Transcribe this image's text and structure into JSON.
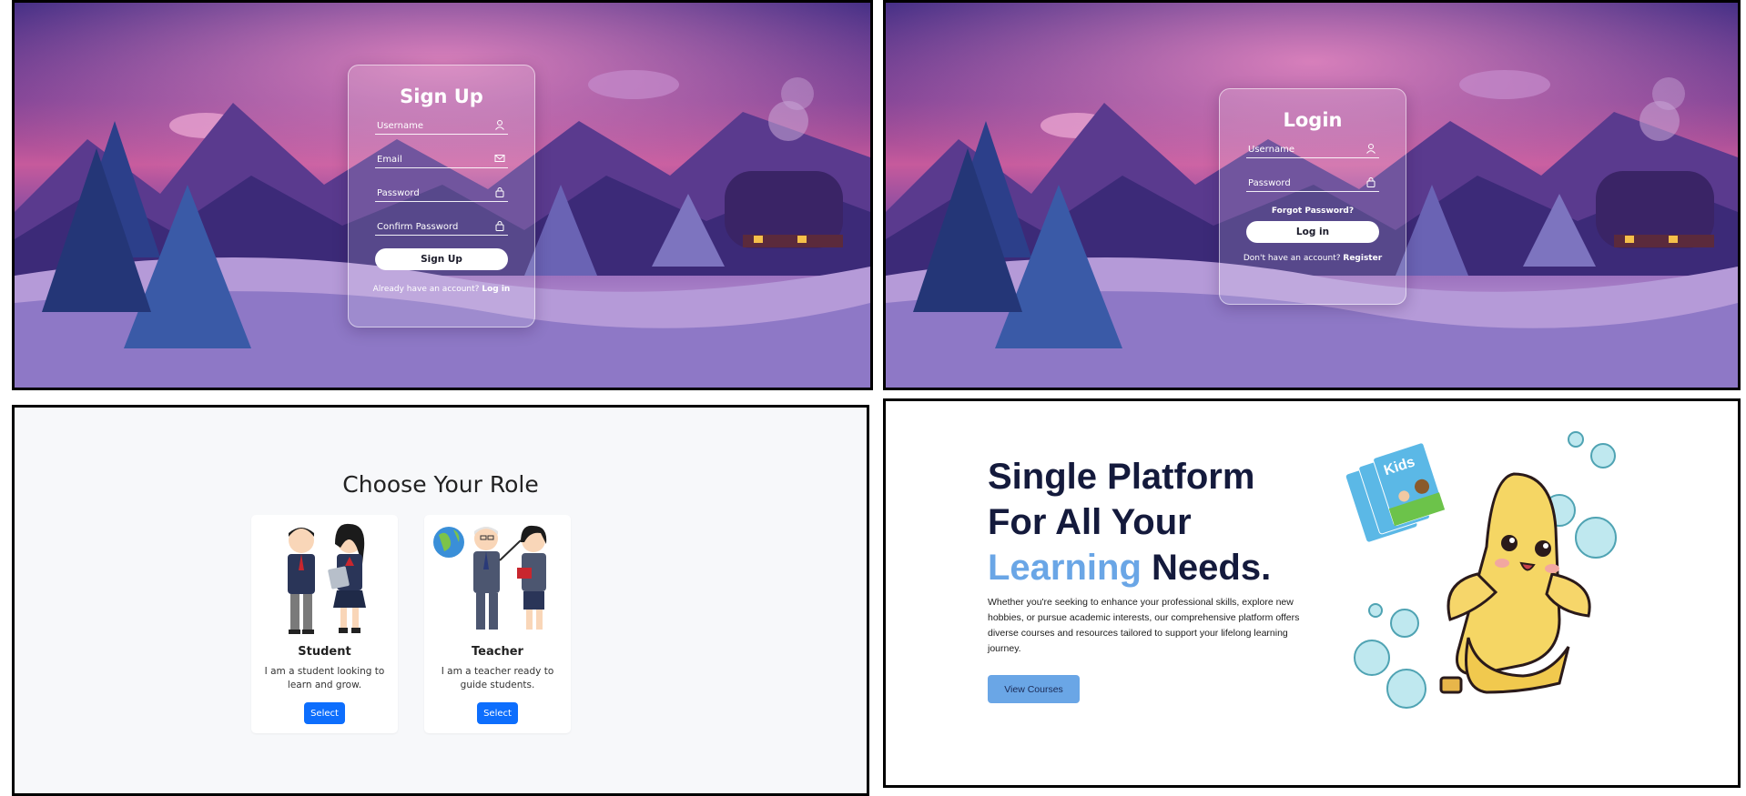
{
  "signup": {
    "title": "Sign Up",
    "username_placeholder": "Username",
    "email_placeholder": "Email",
    "password_placeholder": "Password",
    "confirm_placeholder": "Confirm Password",
    "button_label": "Sign Up",
    "footer_text": "Already have an account?",
    "footer_link": "Log in"
  },
  "login": {
    "title": "Login",
    "username_placeholder": "Username",
    "password_placeholder": "Password",
    "forgot_link": "Forgot Password?",
    "button_label": "Log in",
    "footer_text": "Don't have an account?",
    "footer_link": "Register"
  },
  "roles": {
    "title": "Choose Your Role",
    "cards": [
      {
        "name": "Student",
        "description": "I am a student looking to learn and grow.",
        "button_label": "Select"
      },
      {
        "name": "Teacher",
        "description": "I am a teacher ready to guide students.",
        "button_label": "Select"
      }
    ]
  },
  "landing": {
    "headline_line1": "Single Platform",
    "headline_line2": "For All Your",
    "headline_accent": "Learning",
    "headline_end": "Needs.",
    "description": "Whether you're seeking to enhance your professional skills, explore new hobbies, or pursue academic interests, our comprehensive platform offers diverse courses and resources tailored to support your lifelong learning journey.",
    "cta_label": "View Courses",
    "book_title": "Kids"
  },
  "colors": {
    "accent_blue": "#6aa6e6",
    "select_blue": "#0d6efd",
    "headline_navy": "#141a3c"
  },
  "icons": [
    "user-icon",
    "mail-icon",
    "lock-icon",
    "banana-mascot",
    "bubble"
  ]
}
